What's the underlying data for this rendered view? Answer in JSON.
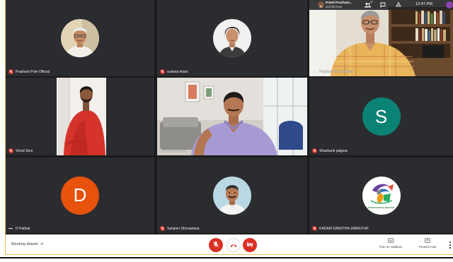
{
  "top_bar": {
    "names": "Preeti Prashant...",
    "more": "and 36 more",
    "count": "37",
    "time": "12:47 PM",
    "icons": [
      "people-icon",
      "chat-icon",
      "activities-icon"
    ]
  },
  "tiles": [
    {
      "name": "Prashant Pole Official",
      "muted": true,
      "speaking": false
    },
    {
      "name": "sudeep tiwari",
      "muted": true,
      "speaking": false
    },
    {
      "name": "Prashant Pole Official",
      "muted": false,
      "speaking": true
    },
    {
      "name": "Vinod Soni",
      "muted": true,
      "speaking": false
    },
    {
      "name": "Prashant pandey",
      "muted": false,
      "speaking": false
    },
    {
      "name": "Shashank palgear",
      "initial": "S",
      "color": "#0b8374",
      "muted": true,
      "speaking": false
    },
    {
      "name": "D Pathak",
      "initial": "D",
      "color": "#e8520c",
      "muted": false,
      "speaking": true
    },
    {
      "name": "Sanjeev Shrivastava",
      "muted": true,
      "speaking": false
    },
    {
      "name": "KADAM SANSTHA JABALPUR",
      "logo_text": "KADAM SANSTHA JABALPUR",
      "muted": true,
      "speaking": false
    }
  ],
  "toolbar": {
    "meeting_details": "Meeting details",
    "captions": "Turn on captions",
    "present": "Present now",
    "icons": [
      "mic-off-icon",
      "hang-up-icon",
      "camera-off-icon",
      "captions-icon",
      "present-icon",
      "more-options-icon"
    ]
  },
  "colors": {
    "stage": "#1b1b1c",
    "tile": "#2b2c2f",
    "mute_red": "#d93025",
    "frame": "#e3bf55"
  }
}
